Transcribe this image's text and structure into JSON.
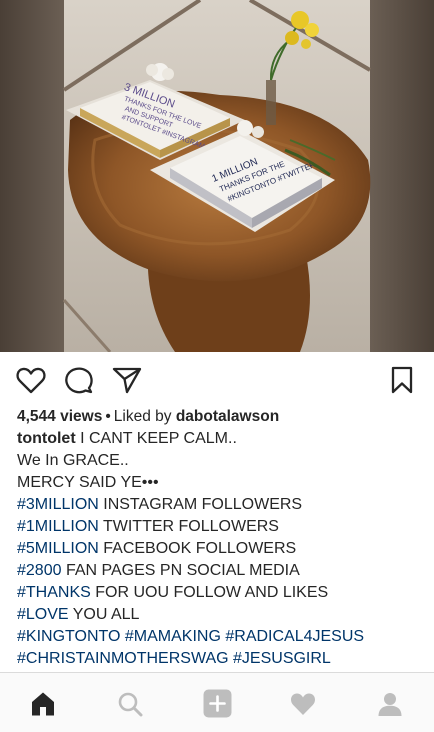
{
  "post": {
    "photo": {
      "alt": "",
      "cake_left_text": [
        "3 MILLION",
        "THANKS FOR THE LOVE",
        "AND SUPPORT",
        "#TONTOLET #INSTAGRAM"
      ],
      "cake_right_text": [
        "1 MILLION",
        "THANKS FOR THE",
        "#KINGTONTO #TWITTER"
      ]
    },
    "actions": {
      "like_icon": "heart-outline-icon",
      "comment_icon": "comment-bubble-icon",
      "share_icon": "paper-plane-icon",
      "save_icon": "bookmark-icon"
    },
    "views_count": "4,544 views",
    "separator": "•",
    "liked_by_prefix": "Liked by",
    "liked_by_user": "dabotalawson",
    "author": "tontolet",
    "caption_lines": [
      {
        "tag": "",
        "text": "I CANT KEEP CALM.."
      },
      {
        "tag": "",
        "text": "We In GRACE.."
      },
      {
        "tag": "",
        "text": "MERCY SAID YE•••"
      },
      {
        "tag": "#3MILLION",
        "text": " INSTAGRAM FOLLOWERS"
      },
      {
        "tag": "#1MILLION",
        "text": " TWITTER FOLLOWERS"
      },
      {
        "tag": "#5MILLION",
        "text": " FACEBOOK FOLLOWERS"
      },
      {
        "tag": "#2800",
        "text": " FAN PAGES PN SOCIAL MEDIA"
      },
      {
        "tag": "#THANKS",
        "text": " FOR UOU FOLLOW AND LIKES"
      },
      {
        "tag": "#LOVE",
        "text": " YOU ALL"
      }
    ],
    "hashtag_line_1": [
      "#KINGTONTO",
      "#MAMAKING",
      "#RADICAL4JESUS"
    ],
    "hashtag_line_2": [
      "#CHRISTAINMOTHERSWAG",
      "#JESUSGIRL"
    ]
  },
  "bottom_nav": {
    "items": [
      {
        "icon": "home-icon",
        "active": true
      },
      {
        "icon": "search-icon",
        "active": false
      },
      {
        "icon": "add-post-icon",
        "active": false
      },
      {
        "icon": "activity-heart-icon",
        "active": false
      },
      {
        "icon": "profile-icon",
        "active": false
      }
    ]
  },
  "colors": {
    "text": "#262626",
    "hashtag": "#003569",
    "nav_inactive": "#bdbdbd",
    "nav_active": "#262626",
    "nav_bg": "#fafafa"
  }
}
